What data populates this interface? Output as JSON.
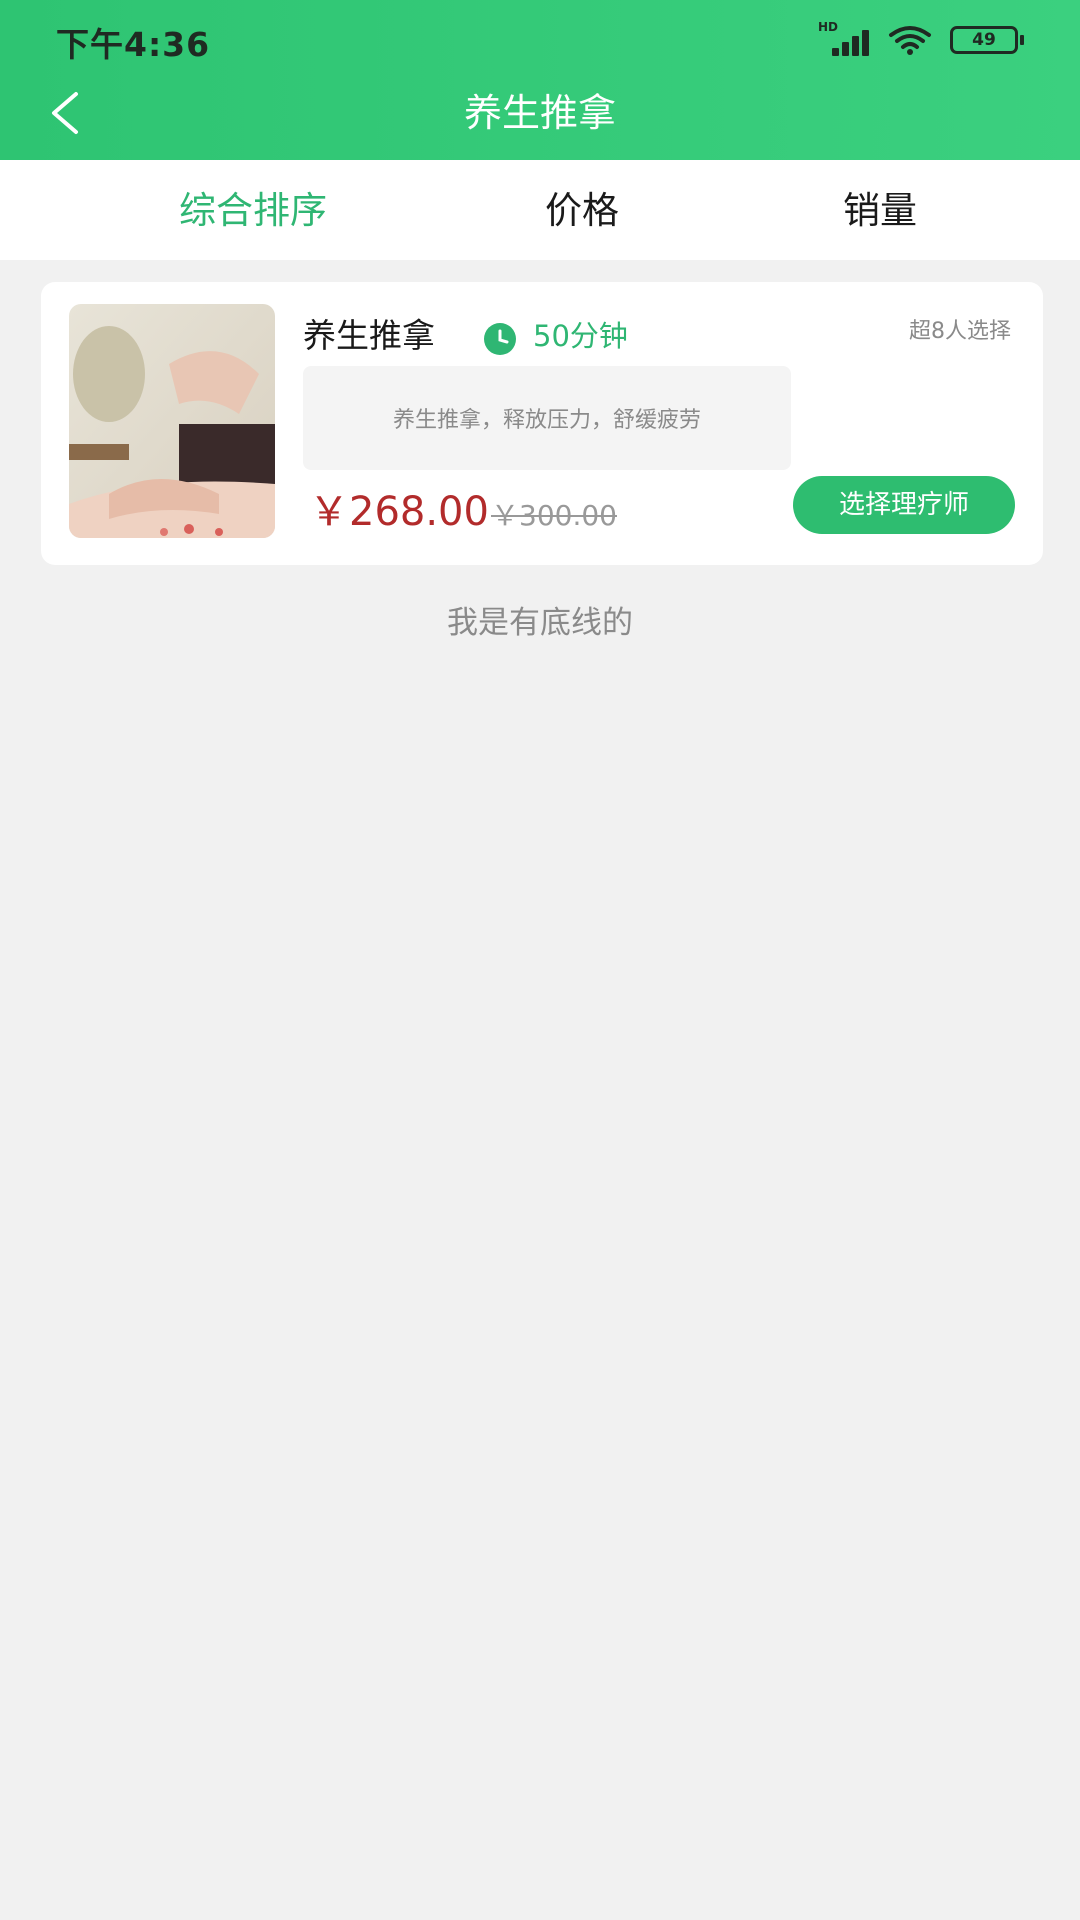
{
  "status_bar": {
    "time": "下午4:36",
    "network_label": "HD",
    "battery": "49"
  },
  "nav": {
    "title": "养生推拿"
  },
  "sort_tabs": [
    {
      "label": "综合排序",
      "active": true
    },
    {
      "label": "价格",
      "active": false
    },
    {
      "label": "销量",
      "active": false
    }
  ],
  "service": {
    "name": "养生推拿",
    "duration": "50分钟",
    "sold": "超8人选择",
    "description": "养生推拿，释放压力，舒缓疲劳",
    "price": "￥268.00",
    "original_price": "￥300.00",
    "action_label": "选择理疗师"
  },
  "footer_note": "我是有底线的",
  "colors": {
    "brand_green": "#2ec472",
    "active_tab": "#2fb673",
    "price_red": "#b22b2b",
    "page_bg": "#f1f1f1"
  }
}
